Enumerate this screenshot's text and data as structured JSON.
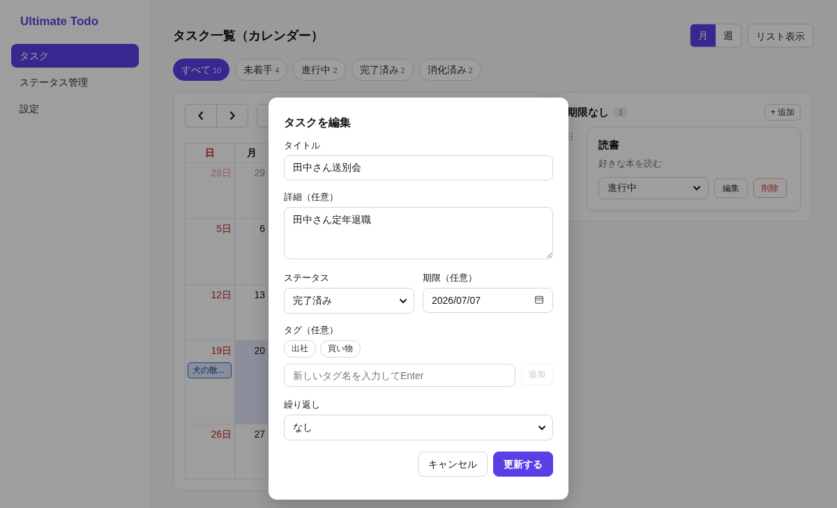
{
  "app": {
    "name": "Ultimate Todo"
  },
  "sidebar": {
    "items": [
      {
        "label": "タスク",
        "selected": true
      },
      {
        "label": "ステータス管理",
        "selected": false
      },
      {
        "label": "設定",
        "selected": false
      }
    ]
  },
  "page_title": "タスク一覧（カレンダー）",
  "view_toggle": [
    {
      "label": "月",
      "selected": true
    },
    {
      "label": "週",
      "selected": false
    }
  ],
  "list_button": "リスト表示",
  "filters": [
    {
      "label": "すべて",
      "count": "10",
      "selected": true
    },
    {
      "label": "未着手",
      "count": "4",
      "selected": false
    },
    {
      "label": "進行中",
      "count": "2",
      "selected": false
    },
    {
      "label": "完了済み",
      "count": "2",
      "selected": false
    },
    {
      "label": "消化済み",
      "count": "2",
      "selected": false
    }
  ],
  "calendar": {
    "weekdays": [
      {
        "label": "日",
        "kind": "sunday"
      },
      {
        "label": "月",
        "kind": "weekday"
      }
    ],
    "weeks": [
      [
        {
          "day": "28日",
          "outside": true,
          "today": false
        },
        {
          "day": "29",
          "outside": true,
          "today": false
        }
      ],
      [
        {
          "day": "5日",
          "outside": false,
          "today": false
        },
        {
          "day": "6",
          "outside": false,
          "today": false
        }
      ],
      [
        {
          "day": "12日",
          "outside": false,
          "today": false
        },
        {
          "day": "13",
          "outside": false,
          "today": false
        }
      ],
      [
        {
          "day": "19日",
          "outside": false,
          "today": false,
          "events": [
            "犬の散..."
          ]
        },
        {
          "day": "20",
          "outside": false,
          "today": true
        }
      ],
      [
        {
          "day": "26日",
          "outside": false,
          "today": false
        },
        {
          "day": "27",
          "outside": false,
          "today": false
        }
      ]
    ]
  },
  "no_deadline": {
    "title": "期限なし",
    "count": "1",
    "add_button": "+ 追加",
    "tasks": [
      {
        "title": "読書",
        "description": "好きな本を読む",
        "status": "進行中",
        "edit": "編集",
        "delete": "削除"
      }
    ]
  },
  "modal": {
    "title": "タスクを編集",
    "title_label": "タイトル",
    "title_value": "田中さん送別会",
    "detail_label": "詳細（任意）",
    "detail_value": "田中さん定年退職",
    "status_label": "ステータス",
    "status_value": "完了済み",
    "due_label": "期限（任意）",
    "due_value": "2026/07/07",
    "tags_label": "タグ（任意）",
    "tags": [
      "出社",
      "買い物"
    ],
    "tag_placeholder": "新しいタグ名を入力してEnter",
    "tag_add": {
      "label": "追加",
      "disabled": true
    },
    "repeat_label": "繰り返し",
    "repeat_value": "なし",
    "buttons": [
      {
        "label": "キャンセル",
        "kind": "secondary"
      },
      {
        "label": "更新する",
        "kind": "primary"
      }
    ]
  }
}
